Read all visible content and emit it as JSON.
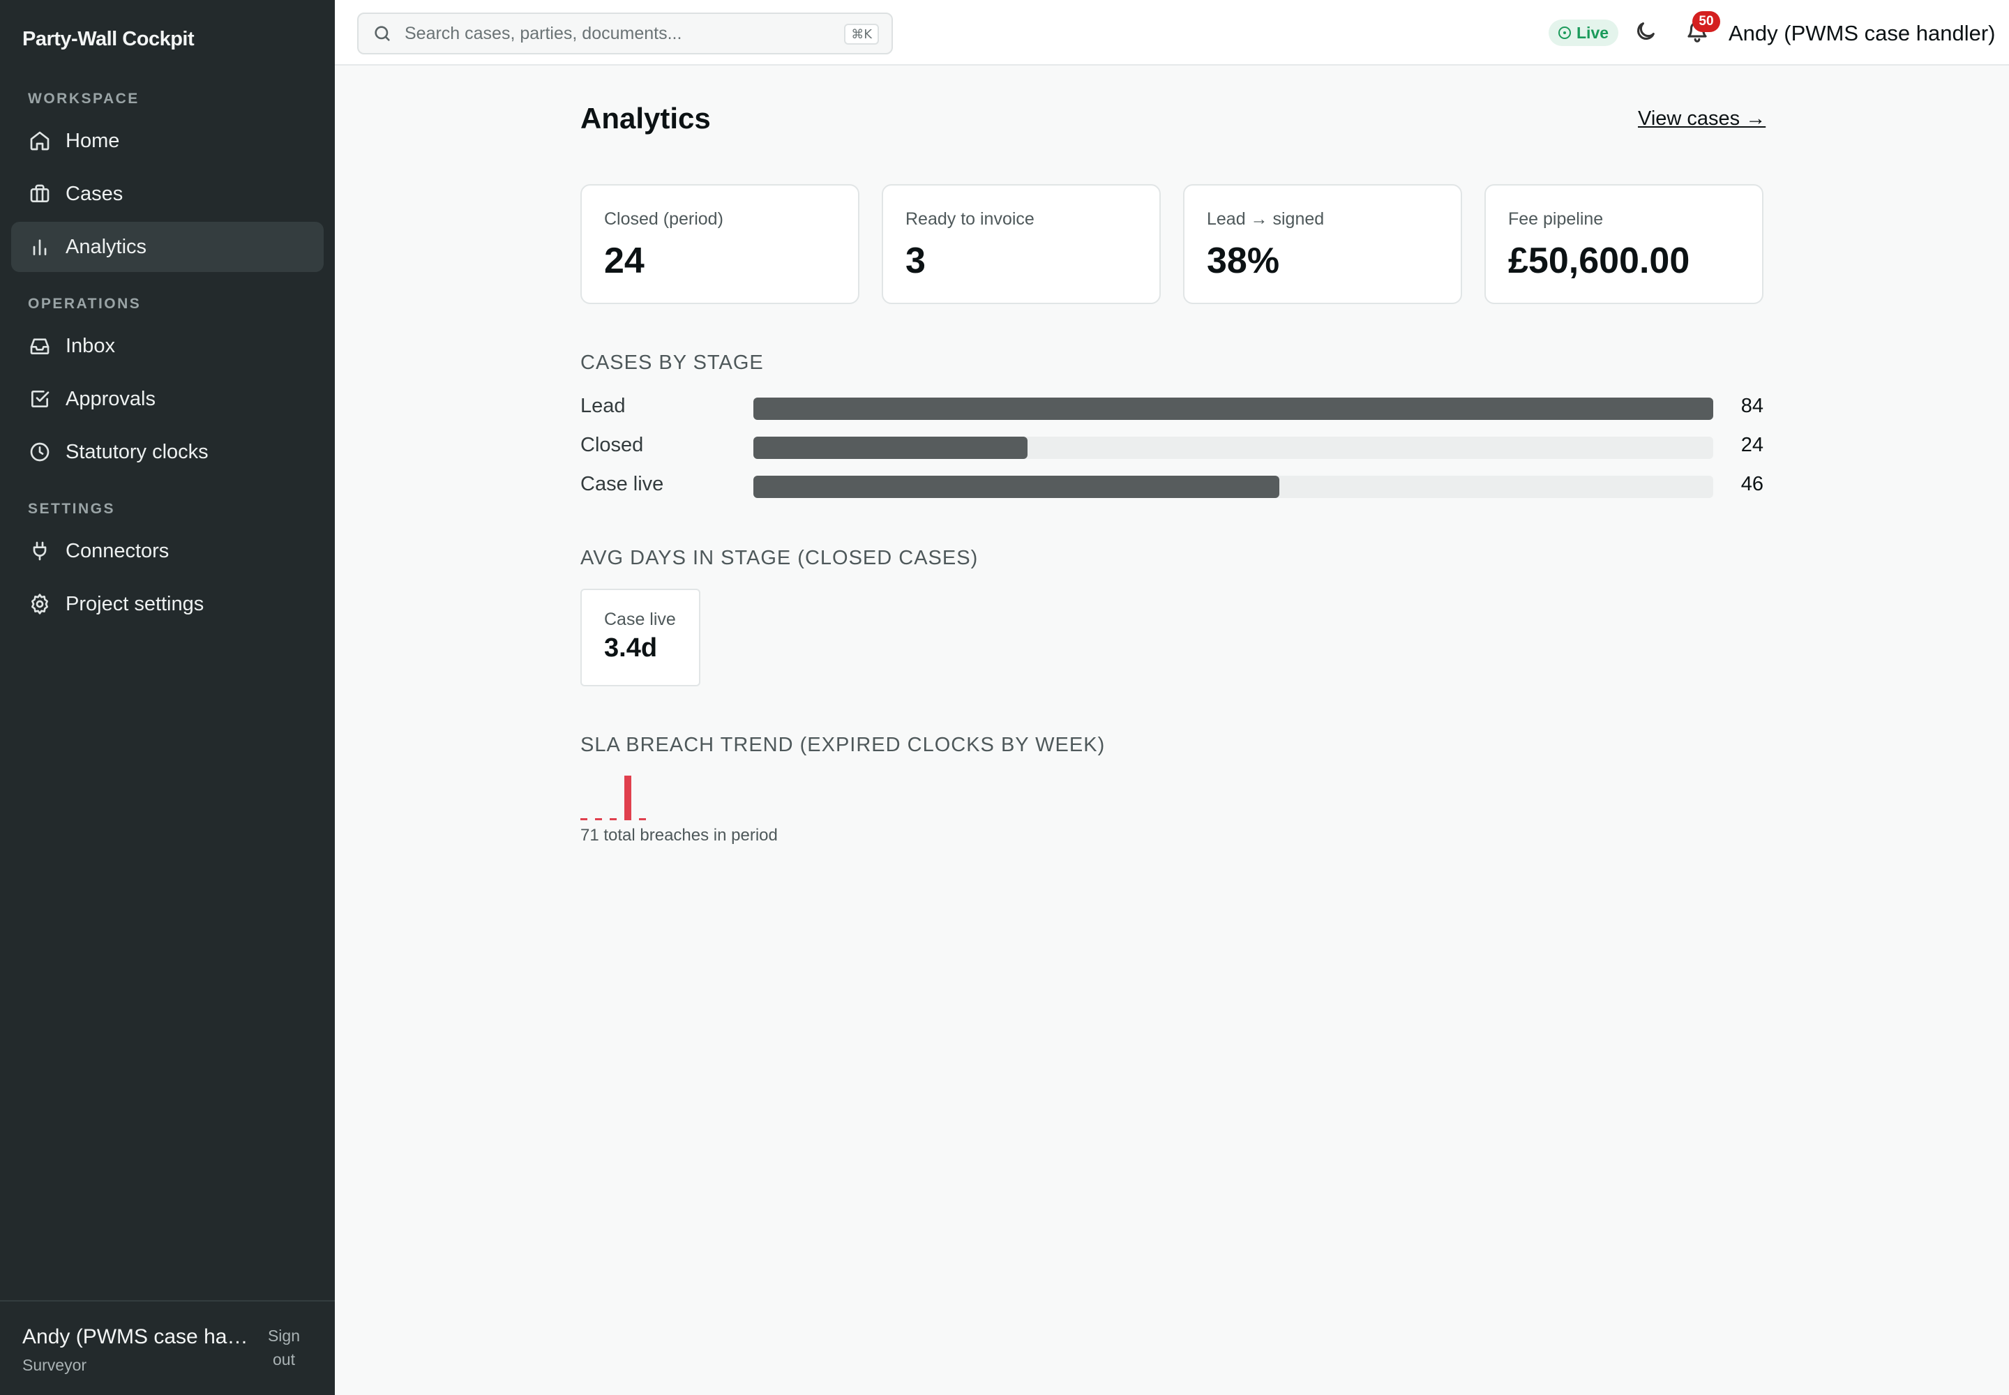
{
  "app": {
    "brand": "Party-Wall Cockpit"
  },
  "sidebar": {
    "sections": [
      {
        "label": "WORKSPACE"
      },
      {
        "label": "OPERATIONS"
      },
      {
        "label": "SETTINGS"
      }
    ],
    "items": [
      {
        "label": "Home",
        "icon": "home-icon"
      },
      {
        "label": "Cases",
        "icon": "briefcase-icon"
      },
      {
        "label": "Analytics",
        "icon": "bar-chart-icon",
        "active": true
      },
      {
        "label": "Inbox",
        "icon": "inbox-icon"
      },
      {
        "label": "Approvals",
        "icon": "check-square-icon"
      },
      {
        "label": "Statutory clocks",
        "icon": "clock-icon"
      },
      {
        "label": "Connectors",
        "icon": "plug-icon"
      },
      {
        "label": "Project settings",
        "icon": "gear-icon"
      }
    ],
    "footer": {
      "name": "Andy (PWMS case handler)",
      "role": "Surveyor",
      "signout": "Sign out"
    }
  },
  "topbar": {
    "search_placeholder": "Search cases, parties, documents...",
    "shortcut": "⌘K",
    "live_label": "Live",
    "notification_count": "50",
    "user": "Andy (PWMS case handler)"
  },
  "main": {
    "title": "Analytics",
    "view_cases": "View cases →",
    "stats": [
      {
        "label": "Closed (period)",
        "value": "24"
      },
      {
        "label": "Ready to invoice",
        "value": "3"
      },
      {
        "label": "Lead → signed",
        "value": "38%"
      },
      {
        "label": "Fee pipeline",
        "value": "£50,600.00"
      }
    ],
    "stage_section": "CASES BY STAGE",
    "avg_section": "AVG DAYS IN STAGE (CLOSED CASES)",
    "avg_cards": [
      {
        "label": "Case live",
        "value": "3.4d"
      }
    ],
    "sla_section": "SLA BREACH TREND (EXPIRED CLOCKS BY WEEK)",
    "sla_note": "71 total breaches in period"
  },
  "colors": {
    "sidebar_bg": "#232a2c",
    "bar_fill": "#575c5d",
    "breach_red": "#e0404e",
    "live_green": "#1a9a5a",
    "badge_red": "#d41f1f"
  },
  "chart_data": [
    {
      "type": "bar",
      "title": "CASES BY STAGE",
      "categories": [
        "Lead",
        "Closed",
        "Case live"
      ],
      "values": [
        84,
        24,
        46
      ],
      "ylim": [
        0,
        84
      ]
    },
    {
      "type": "bar",
      "title": "SLA BREACH TREND (EXPIRED CLOCKS BY WEEK)",
      "categories": [
        "1",
        "2",
        "3",
        "4",
        "5"
      ],
      "values": [
        0,
        0,
        0,
        71,
        0
      ],
      "ylim": [
        0,
        71
      ]
    }
  ]
}
